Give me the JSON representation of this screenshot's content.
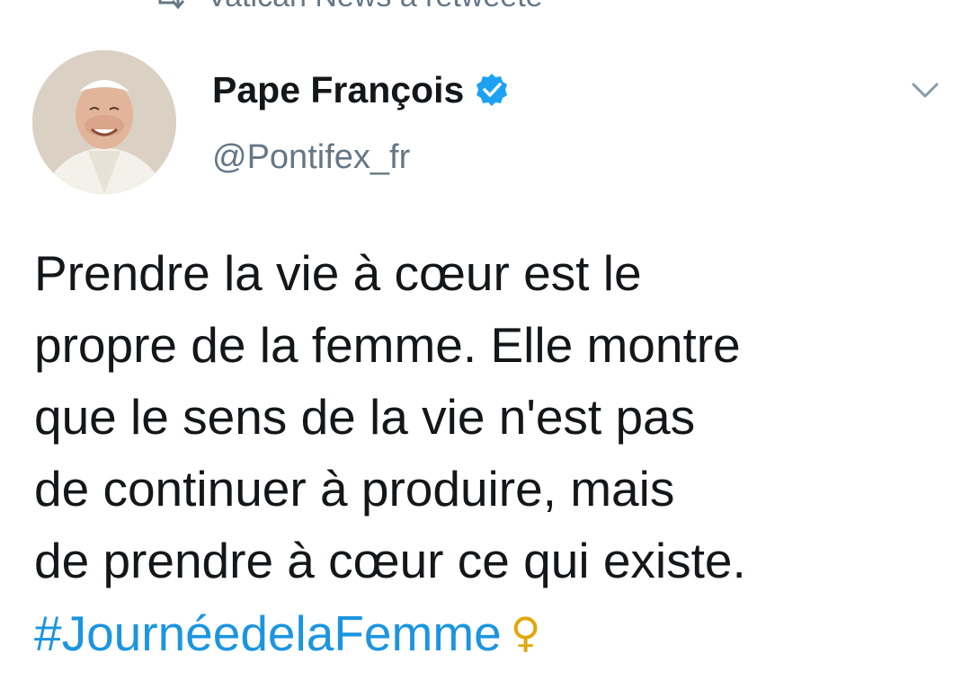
{
  "retweet": {
    "label": "Vatican News a retweeté",
    "icon": "retweet-icon"
  },
  "author": {
    "display_name": "Pape François",
    "handle": "@Pontifex_fr",
    "verified": true,
    "verified_icon": "verified-badge-icon",
    "avatar_icon": "avatar"
  },
  "menu": {
    "icon": "chevron-down-icon"
  },
  "tweet": {
    "lines": [
      "Prendre la vie à cœur est le",
      "propre de la femme. Elle montre",
      "que le sens de la vie n'est pas",
      "de continuer à produire, mais",
      "de prendre à cœur ce qui existe."
    ],
    "hashtag": "#JournéedelaFemme",
    "emoji": "♀"
  },
  "colors": {
    "text": "#14171a",
    "secondary": "#657786",
    "link": "#1b95e0",
    "verified": "#1da1f2",
    "emoji": "#e0a80c"
  }
}
